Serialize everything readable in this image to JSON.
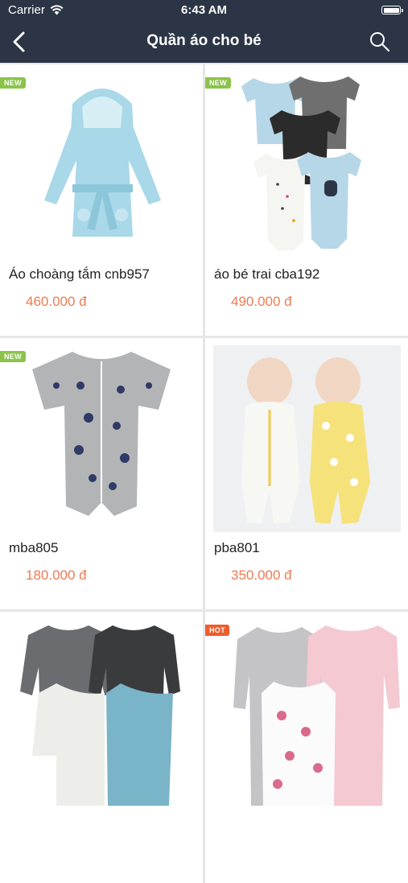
{
  "status_bar": {
    "carrier": "Carrier",
    "time": "6:43 AM",
    "battery_level": 1.0
  },
  "nav": {
    "title": "Quần áo cho bé",
    "back_icon": "chevron-left-icon",
    "search_icon": "search-icon"
  },
  "colors": {
    "nav_bg": "#2b3546",
    "price": "#ef7a52",
    "badge_new": "#8bc34a",
    "badge_hot": "#ef5c2b",
    "grid_bg": "#e6e6e6"
  },
  "products": [
    {
      "name": "Áo choàng tắm cnb957",
      "price": "460.000 đ",
      "badge": "NEW"
    },
    {
      "name": "áo bé trai cba192",
      "price": "490.000 đ",
      "badge": "NEW"
    },
    {
      "name": "mba805",
      "price": "180.000 đ",
      "badge": "NEW"
    },
    {
      "name": "pba801",
      "price": "350.000 đ",
      "badge": ""
    },
    {
      "name": "",
      "price": "",
      "badge": ""
    },
    {
      "name": "",
      "price": "",
      "badge": "HOT"
    }
  ]
}
